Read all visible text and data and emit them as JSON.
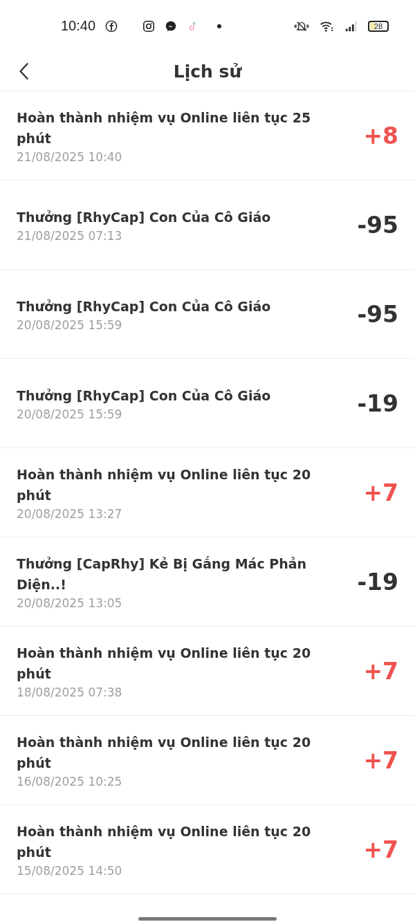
{
  "status_bar": {
    "time": "10:40",
    "battery": "28"
  },
  "header": {
    "title": "Lịch sử"
  },
  "rows": [
    {
      "title": "Hoàn thành nhiệm vụ Online liên tục 25 phút",
      "date": "21/08/2025 10:40",
      "amount": "+8",
      "kind": "gain"
    },
    {
      "title": "Thưởng [RhyCap] Con Của Cô Giáo",
      "date": "21/08/2025 07:13",
      "amount": "-95",
      "kind": "loss"
    },
    {
      "title": "Thưởng [RhyCap] Con Của Cô Giáo",
      "date": "20/08/2025 15:59",
      "amount": "-95",
      "kind": "loss"
    },
    {
      "title": "Thưởng [RhyCap] Con Của Cô Giáo",
      "date": "20/08/2025 15:59",
      "amount": "-19",
      "kind": "loss"
    },
    {
      "title": "Hoàn thành nhiệm vụ Online liên tục 20 phút",
      "date": "20/08/2025 13:27",
      "amount": "+7",
      "kind": "gain"
    },
    {
      "title": "Thưởng [CapRhy] Kẻ Bị Gắng Mác Phản Diện..!",
      "date": "20/08/2025 13:05",
      "amount": "-19",
      "kind": "loss"
    },
    {
      "title": "Hoàn thành nhiệm vụ Online liên tục 20 phút",
      "date": "18/08/2025 07:38",
      "amount": "+7",
      "kind": "gain"
    },
    {
      "title": "Hoàn thành nhiệm vụ Online liên tục 20 phút",
      "date": "16/08/2025 10:25",
      "amount": "+7",
      "kind": "gain"
    },
    {
      "title": "Hoàn thành nhiệm vụ Online liên tục 20 phút",
      "date": "15/08/2025 14:50",
      "amount": "+7",
      "kind": "gain"
    }
  ]
}
